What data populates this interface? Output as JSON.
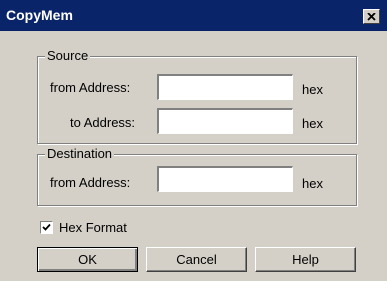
{
  "window": {
    "title": "CopyMem"
  },
  "source": {
    "group_label": "Source",
    "from_label": "from Address:",
    "from_value": "",
    "from_unit": "hex",
    "to_label": "to Address:",
    "to_value": "",
    "to_unit": "hex"
  },
  "destination": {
    "group_label": "Destination",
    "from_label": "from Address:",
    "from_value": "",
    "from_unit": "hex"
  },
  "options": {
    "hex_format_label": "Hex Format",
    "hex_format_checked": true
  },
  "buttons": {
    "ok": "OK",
    "cancel": "Cancel",
    "help": "Help"
  }
}
